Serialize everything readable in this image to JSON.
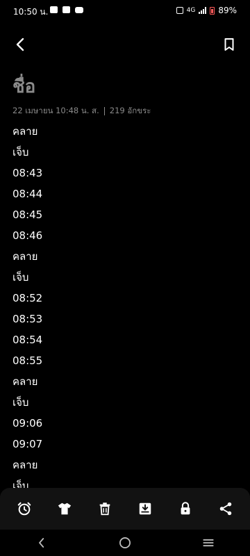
{
  "status_bar": {
    "time": "10:50 น.",
    "network": "4G",
    "battery": "89%"
  },
  "note": {
    "title": "ชื่อ",
    "date": "22 เมษายน 10:48 น. ส.",
    "char_count": "219 อักขระ",
    "lines": [
      "คลาย",
      "เจ็บ",
      "08:43",
      "08:44",
      "08:45",
      "08:46",
      "คลาย",
      "เจ็บ",
      "08:52",
      "08:53",
      "08:54",
      "08:55",
      "คลาย",
      "เจ็บ",
      "09:06",
      "09:07",
      "คลาย",
      "เจ็บ"
    ]
  },
  "toolbar": {
    "items": [
      "alarm-icon",
      "shirt-icon",
      "trash-icon",
      "download-icon",
      "lock-icon",
      "share-icon"
    ]
  },
  "colors": {
    "background": "#000000",
    "title": "#8a8a8a",
    "toolbar": "#121212",
    "battery_low": "#ff5a5a"
  }
}
